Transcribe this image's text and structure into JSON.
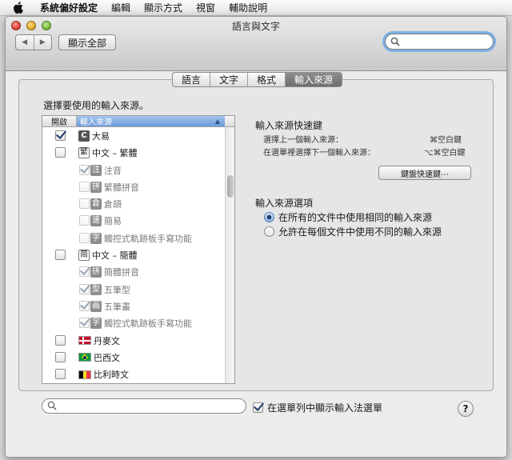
{
  "menubar": {
    "apple": "apple-logo",
    "items": [
      "系統偏好設定",
      "編輯",
      "顯示方式",
      "視窗",
      "輔助說明"
    ]
  },
  "window": {
    "title": "語言與文字",
    "back_icon": "◀",
    "forward_icon": "▶",
    "show_all": "顯示全部",
    "search_value": ""
  },
  "tabs": [
    {
      "label": "語言",
      "active": false
    },
    {
      "label": "文字",
      "active": false
    },
    {
      "label": "格式",
      "active": false
    },
    {
      "label": "輸入來源",
      "active": true
    }
  ],
  "prompt": "選擇要使用的輸入來源。",
  "list": {
    "col_enable": "開啟",
    "col_source": "輸入來源",
    "sort_indicator": "▲",
    "rows": [
      {
        "label": "大易",
        "icon": "C",
        "icon_style": "dark",
        "checked": true,
        "indent": false,
        "dim": false
      },
      {
        "label": "中文 – 繁體",
        "icon": "繁",
        "icon_style": "box",
        "checked": false,
        "indent": false,
        "dim": false
      },
      {
        "label": "注音",
        "icon": "注",
        "icon_style": "grey",
        "checked": true,
        "indent": true,
        "dim": true
      },
      {
        "label": "繁體拼音",
        "icon": "拼",
        "icon_style": "grey",
        "checked": false,
        "indent": true,
        "dim": true
      },
      {
        "label": "倉頡",
        "icon": "倉",
        "icon_style": "grey",
        "checked": false,
        "indent": true,
        "dim": true
      },
      {
        "label": "簡易",
        "icon": "速",
        "icon_style": "grey",
        "checked": false,
        "indent": true,
        "dim": true
      },
      {
        "label": "觸控式軌跡板手寫功能",
        "icon": "字",
        "icon_style": "grey",
        "checked": false,
        "indent": true,
        "dim": true
      },
      {
        "label": "中文 – 簡體",
        "icon": "简",
        "icon_style": "box",
        "checked": false,
        "indent": false,
        "dim": false
      },
      {
        "label": "簡體拼音",
        "icon": "拼",
        "icon_style": "grey",
        "checked": true,
        "indent": true,
        "dim": true
      },
      {
        "label": "五筆型",
        "icon": "型",
        "icon_style": "grey",
        "checked": true,
        "indent": true,
        "dim": true
      },
      {
        "label": "五筆畫",
        "icon": "画",
        "icon_style": "grey",
        "checked": true,
        "indent": true,
        "dim": true
      },
      {
        "label": "觸控式軌跡板手寫功能",
        "icon": "字",
        "icon_style": "grey",
        "checked": true,
        "indent": true,
        "dim": true
      },
      {
        "label": "丹麥文",
        "icon": "flag-denmark",
        "icon_style": "flag",
        "checked": false,
        "indent": false,
        "dim": false
      },
      {
        "label": "巴西文",
        "icon": "flag-brazil",
        "icon_style": "flag",
        "checked": false,
        "indent": false,
        "dim": false
      },
      {
        "label": "比利時文",
        "icon": "flag-belgium",
        "icon_style": "flag",
        "checked": false,
        "indent": false,
        "dim": false
      }
    ]
  },
  "shortcuts": {
    "heading": "輸入來源快速鍵",
    "items": [
      {
        "label": "選擇上一個輸入來源：",
        "keys": "⌘空白鍵"
      },
      {
        "label": "在選單裡選擇下一個輸入來源：",
        "keys": "⌥⌘空白鍵"
      }
    ],
    "button": "鍵盤快速鍵⋯"
  },
  "options": {
    "heading": "輸入來源選項",
    "radios": [
      {
        "label": "在所有的文件中使用相同的輸入來源",
        "selected": true
      },
      {
        "label": "允許在每個文件中使用不同的輸入來源",
        "selected": false
      }
    ]
  },
  "footer": {
    "search_value": "",
    "menu_check_label": "在選單列中顯示輸入法選單",
    "menu_check_checked": true,
    "help": "?"
  },
  "colors": {
    "accent": "#6b9ad8",
    "focus_ring": "#7fb0e6"
  }
}
